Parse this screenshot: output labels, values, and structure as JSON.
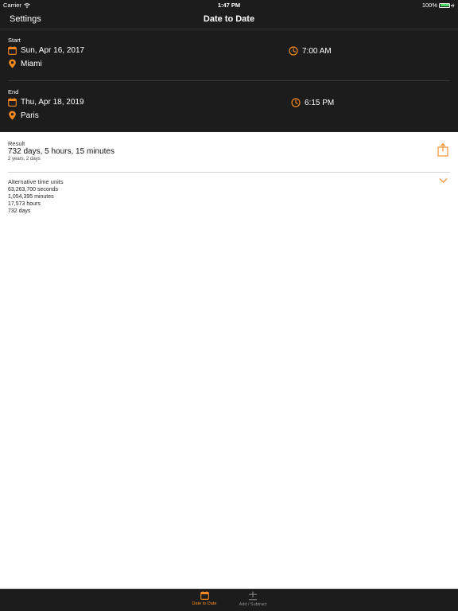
{
  "status": {
    "carrier": "Carrier",
    "time": "1:47 PM",
    "battery": "100%"
  },
  "nav": {
    "left": "Settings",
    "title": "Date to Date"
  },
  "start": {
    "label": "Start",
    "date": "Sun, Apr 16, 2017",
    "time": "7:00 AM",
    "location": "Miami"
  },
  "end": {
    "label": "End",
    "date": "Thu, Apr 18, 2019",
    "time": "6:15 PM",
    "location": "Paris"
  },
  "result": {
    "label": "Result",
    "main": "732 days, 5 hours, 15 minutes",
    "sub": "2 years, 2 days"
  },
  "alternative": {
    "label": "Alternative time units",
    "items": [
      "63,263,700 seconds",
      "1,054,395 minutes",
      "17,573 hours",
      "732 days"
    ]
  },
  "tabs": [
    {
      "label": "Date to Date",
      "active": true
    },
    {
      "label": "Add / Subtract",
      "active": false
    }
  ],
  "colors": {
    "accent": "#f5891f",
    "dark_bg": "#1c1c1c",
    "inactive_tab": "#8e8e8e"
  },
  "icons": {
    "date": "calendar-icon",
    "time": "clock-icon",
    "location": "location-pin-icon",
    "share": "share-icon",
    "expand": "chevron-down-icon",
    "add_subtract": "plus-minus-icon"
  }
}
